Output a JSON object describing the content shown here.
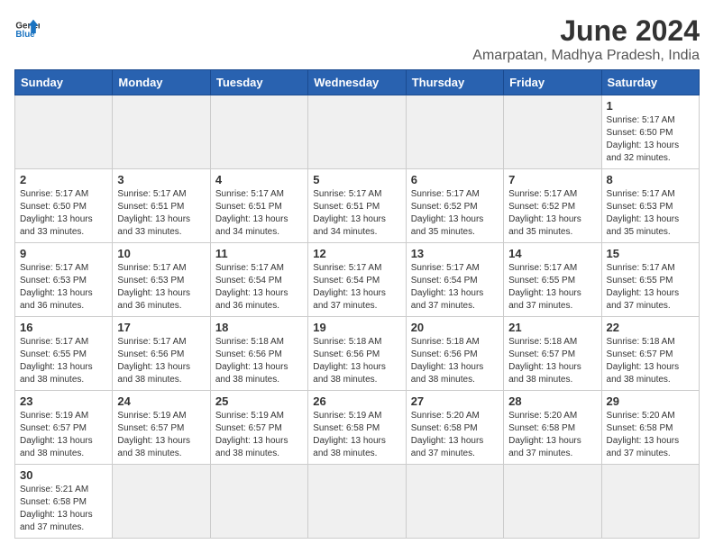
{
  "logo": {
    "text_general": "General",
    "text_blue": "Blue"
  },
  "title": "June 2024",
  "location": "Amarpatan, Madhya Pradesh, India",
  "weekdays": [
    "Sunday",
    "Monday",
    "Tuesday",
    "Wednesday",
    "Thursday",
    "Friday",
    "Saturday"
  ],
  "weeks": [
    [
      {
        "day": "",
        "empty": true
      },
      {
        "day": "",
        "empty": true
      },
      {
        "day": "",
        "empty": true
      },
      {
        "day": "",
        "empty": true
      },
      {
        "day": "",
        "empty": true
      },
      {
        "day": "",
        "empty": true
      },
      {
        "day": "1",
        "sunrise": "5:17 AM",
        "sunset": "6:50 PM",
        "daylight": "13 hours and 32 minutes."
      }
    ],
    [
      {
        "day": "2",
        "sunrise": "5:17 AM",
        "sunset": "6:50 PM",
        "daylight": "13 hours and 33 minutes."
      },
      {
        "day": "3",
        "sunrise": "5:17 AM",
        "sunset": "6:51 PM",
        "daylight": "13 hours and 33 minutes."
      },
      {
        "day": "4",
        "sunrise": "5:17 AM",
        "sunset": "6:51 PM",
        "daylight": "13 hours and 34 minutes."
      },
      {
        "day": "5",
        "sunrise": "5:17 AM",
        "sunset": "6:51 PM",
        "daylight": "13 hours and 34 minutes."
      },
      {
        "day": "6",
        "sunrise": "5:17 AM",
        "sunset": "6:52 PM",
        "daylight": "13 hours and 35 minutes."
      },
      {
        "day": "7",
        "sunrise": "5:17 AM",
        "sunset": "6:52 PM",
        "daylight": "13 hours and 35 minutes."
      },
      {
        "day": "8",
        "sunrise": "5:17 AM",
        "sunset": "6:53 PM",
        "daylight": "13 hours and 35 minutes."
      }
    ],
    [
      {
        "day": "9",
        "sunrise": "5:17 AM",
        "sunset": "6:53 PM",
        "daylight": "13 hours and 36 minutes."
      },
      {
        "day": "10",
        "sunrise": "5:17 AM",
        "sunset": "6:53 PM",
        "daylight": "13 hours and 36 minutes."
      },
      {
        "day": "11",
        "sunrise": "5:17 AM",
        "sunset": "6:54 PM",
        "daylight": "13 hours and 36 minutes."
      },
      {
        "day": "12",
        "sunrise": "5:17 AM",
        "sunset": "6:54 PM",
        "daylight": "13 hours and 37 minutes."
      },
      {
        "day": "13",
        "sunrise": "5:17 AM",
        "sunset": "6:54 PM",
        "daylight": "13 hours and 37 minutes."
      },
      {
        "day": "14",
        "sunrise": "5:17 AM",
        "sunset": "6:55 PM",
        "daylight": "13 hours and 37 minutes."
      },
      {
        "day": "15",
        "sunrise": "5:17 AM",
        "sunset": "6:55 PM",
        "daylight": "13 hours and 37 minutes."
      }
    ],
    [
      {
        "day": "16",
        "sunrise": "5:17 AM",
        "sunset": "6:55 PM",
        "daylight": "13 hours and 38 minutes."
      },
      {
        "day": "17",
        "sunrise": "5:17 AM",
        "sunset": "6:56 PM",
        "daylight": "13 hours and 38 minutes."
      },
      {
        "day": "18",
        "sunrise": "5:18 AM",
        "sunset": "6:56 PM",
        "daylight": "13 hours and 38 minutes."
      },
      {
        "day": "19",
        "sunrise": "5:18 AM",
        "sunset": "6:56 PM",
        "daylight": "13 hours and 38 minutes."
      },
      {
        "day": "20",
        "sunrise": "5:18 AM",
        "sunset": "6:56 PM",
        "daylight": "13 hours and 38 minutes."
      },
      {
        "day": "21",
        "sunrise": "5:18 AM",
        "sunset": "6:57 PM",
        "daylight": "13 hours and 38 minutes."
      },
      {
        "day": "22",
        "sunrise": "5:18 AM",
        "sunset": "6:57 PM",
        "daylight": "13 hours and 38 minutes."
      }
    ],
    [
      {
        "day": "23",
        "sunrise": "5:19 AM",
        "sunset": "6:57 PM",
        "daylight": "13 hours and 38 minutes."
      },
      {
        "day": "24",
        "sunrise": "5:19 AM",
        "sunset": "6:57 PM",
        "daylight": "13 hours and 38 minutes."
      },
      {
        "day": "25",
        "sunrise": "5:19 AM",
        "sunset": "6:57 PM",
        "daylight": "13 hours and 38 minutes."
      },
      {
        "day": "26",
        "sunrise": "5:19 AM",
        "sunset": "6:58 PM",
        "daylight": "13 hours and 38 minutes."
      },
      {
        "day": "27",
        "sunrise": "5:20 AM",
        "sunset": "6:58 PM",
        "daylight": "13 hours and 37 minutes."
      },
      {
        "day": "28",
        "sunrise": "5:20 AM",
        "sunset": "6:58 PM",
        "daylight": "13 hours and 37 minutes."
      },
      {
        "day": "29",
        "sunrise": "5:20 AM",
        "sunset": "6:58 PM",
        "daylight": "13 hours and 37 minutes."
      }
    ],
    [
      {
        "day": "30",
        "sunrise": "5:21 AM",
        "sunset": "6:58 PM",
        "daylight": "13 hours and 37 minutes."
      },
      {
        "day": "",
        "empty": true
      },
      {
        "day": "",
        "empty": true
      },
      {
        "day": "",
        "empty": true
      },
      {
        "day": "",
        "empty": true
      },
      {
        "day": "",
        "empty": true
      },
      {
        "day": "",
        "empty": true
      }
    ]
  ],
  "labels": {
    "sunrise": "Sunrise:",
    "sunset": "Sunset:",
    "daylight": "Daylight:"
  }
}
